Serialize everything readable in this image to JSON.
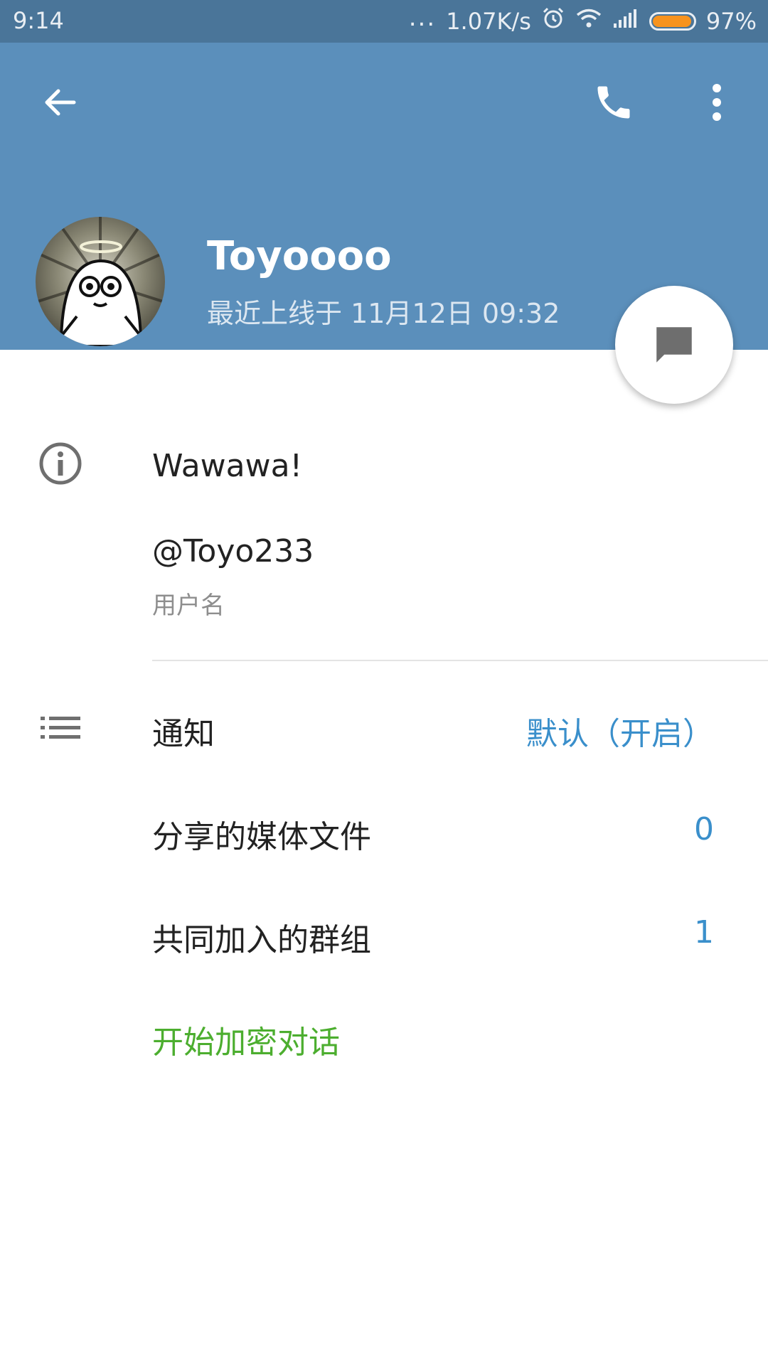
{
  "status_bar": {
    "time": "9:14",
    "dots": "...",
    "network_speed": "1.07K/s",
    "battery_percent": "97%",
    "battery_level": 0.97,
    "battery_color": "#f7931e",
    "icons": [
      "alarm-icon",
      "wifi-icon",
      "signal-icon",
      "battery-icon"
    ]
  },
  "header": {
    "background": "#5b8fbb",
    "back_icon": "arrow-left-icon",
    "call_icon": "phone-icon",
    "menu_icon": "more-vert-icon",
    "name": "Toyoooo",
    "last_seen": "最近上线于 11月12日 09:32"
  },
  "fab": {
    "icon": "chat-bubble-icon"
  },
  "info": {
    "icon": "info-icon",
    "bio": "Wawawa!",
    "username": "@Toyo233",
    "username_label": "用户名"
  },
  "settings": {
    "icon": "list-icon",
    "notifications_label": "通知",
    "notifications_value": "默认（开启）",
    "shared_media_label": "分享的媒体文件",
    "shared_media_value": "0",
    "groups_in_common_label": "共同加入的群组",
    "groups_in_common_value": "1",
    "secret_chat_label": "开始加密对话"
  },
  "colors": {
    "accent_blue": "#3a8fcb",
    "secret_green": "#4cae2f"
  }
}
